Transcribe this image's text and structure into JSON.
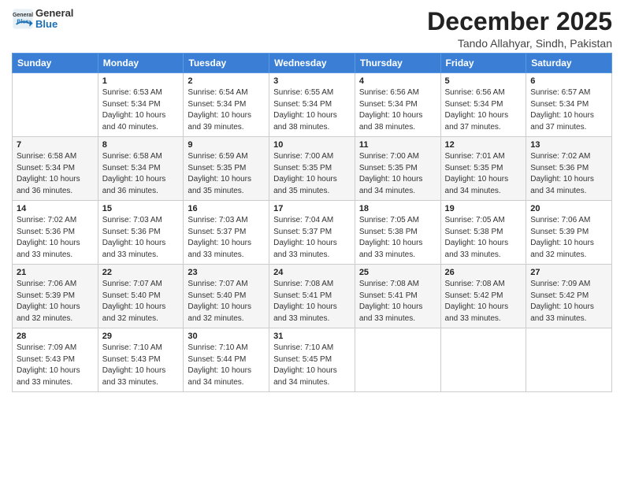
{
  "logo": {
    "line1": "General",
    "line2": "Blue"
  },
  "header": {
    "month": "December 2025",
    "location": "Tando Allahyar, Sindh, Pakistan"
  },
  "weekdays": [
    "Sunday",
    "Monday",
    "Tuesday",
    "Wednesday",
    "Thursday",
    "Friday",
    "Saturday"
  ],
  "weeks": [
    [
      {
        "day": "",
        "info": ""
      },
      {
        "day": "1",
        "info": "Sunrise: 6:53 AM\nSunset: 5:34 PM\nDaylight: 10 hours\nand 40 minutes."
      },
      {
        "day": "2",
        "info": "Sunrise: 6:54 AM\nSunset: 5:34 PM\nDaylight: 10 hours\nand 39 minutes."
      },
      {
        "day": "3",
        "info": "Sunrise: 6:55 AM\nSunset: 5:34 PM\nDaylight: 10 hours\nand 38 minutes."
      },
      {
        "day": "4",
        "info": "Sunrise: 6:56 AM\nSunset: 5:34 PM\nDaylight: 10 hours\nand 38 minutes."
      },
      {
        "day": "5",
        "info": "Sunrise: 6:56 AM\nSunset: 5:34 PM\nDaylight: 10 hours\nand 37 minutes."
      },
      {
        "day": "6",
        "info": "Sunrise: 6:57 AM\nSunset: 5:34 PM\nDaylight: 10 hours\nand 37 minutes."
      }
    ],
    [
      {
        "day": "7",
        "info": "Sunrise: 6:58 AM\nSunset: 5:34 PM\nDaylight: 10 hours\nand 36 minutes."
      },
      {
        "day": "8",
        "info": "Sunrise: 6:58 AM\nSunset: 5:34 PM\nDaylight: 10 hours\nand 36 minutes."
      },
      {
        "day": "9",
        "info": "Sunrise: 6:59 AM\nSunset: 5:35 PM\nDaylight: 10 hours\nand 35 minutes."
      },
      {
        "day": "10",
        "info": "Sunrise: 7:00 AM\nSunset: 5:35 PM\nDaylight: 10 hours\nand 35 minutes."
      },
      {
        "day": "11",
        "info": "Sunrise: 7:00 AM\nSunset: 5:35 PM\nDaylight: 10 hours\nand 34 minutes."
      },
      {
        "day": "12",
        "info": "Sunrise: 7:01 AM\nSunset: 5:35 PM\nDaylight: 10 hours\nand 34 minutes."
      },
      {
        "day": "13",
        "info": "Sunrise: 7:02 AM\nSunset: 5:36 PM\nDaylight: 10 hours\nand 34 minutes."
      }
    ],
    [
      {
        "day": "14",
        "info": "Sunrise: 7:02 AM\nSunset: 5:36 PM\nDaylight: 10 hours\nand 33 minutes."
      },
      {
        "day": "15",
        "info": "Sunrise: 7:03 AM\nSunset: 5:36 PM\nDaylight: 10 hours\nand 33 minutes."
      },
      {
        "day": "16",
        "info": "Sunrise: 7:03 AM\nSunset: 5:37 PM\nDaylight: 10 hours\nand 33 minutes."
      },
      {
        "day": "17",
        "info": "Sunrise: 7:04 AM\nSunset: 5:37 PM\nDaylight: 10 hours\nand 33 minutes."
      },
      {
        "day": "18",
        "info": "Sunrise: 7:05 AM\nSunset: 5:38 PM\nDaylight: 10 hours\nand 33 minutes."
      },
      {
        "day": "19",
        "info": "Sunrise: 7:05 AM\nSunset: 5:38 PM\nDaylight: 10 hours\nand 33 minutes."
      },
      {
        "day": "20",
        "info": "Sunrise: 7:06 AM\nSunset: 5:39 PM\nDaylight: 10 hours\nand 32 minutes."
      }
    ],
    [
      {
        "day": "21",
        "info": "Sunrise: 7:06 AM\nSunset: 5:39 PM\nDaylight: 10 hours\nand 32 minutes."
      },
      {
        "day": "22",
        "info": "Sunrise: 7:07 AM\nSunset: 5:40 PM\nDaylight: 10 hours\nand 32 minutes."
      },
      {
        "day": "23",
        "info": "Sunrise: 7:07 AM\nSunset: 5:40 PM\nDaylight: 10 hours\nand 32 minutes."
      },
      {
        "day": "24",
        "info": "Sunrise: 7:08 AM\nSunset: 5:41 PM\nDaylight: 10 hours\nand 33 minutes."
      },
      {
        "day": "25",
        "info": "Sunrise: 7:08 AM\nSunset: 5:41 PM\nDaylight: 10 hours\nand 33 minutes."
      },
      {
        "day": "26",
        "info": "Sunrise: 7:08 AM\nSunset: 5:42 PM\nDaylight: 10 hours\nand 33 minutes."
      },
      {
        "day": "27",
        "info": "Sunrise: 7:09 AM\nSunset: 5:42 PM\nDaylight: 10 hours\nand 33 minutes."
      }
    ],
    [
      {
        "day": "28",
        "info": "Sunrise: 7:09 AM\nSunset: 5:43 PM\nDaylight: 10 hours\nand 33 minutes."
      },
      {
        "day": "29",
        "info": "Sunrise: 7:10 AM\nSunset: 5:43 PM\nDaylight: 10 hours\nand 33 minutes."
      },
      {
        "day": "30",
        "info": "Sunrise: 7:10 AM\nSunset: 5:44 PM\nDaylight: 10 hours\nand 34 minutes."
      },
      {
        "day": "31",
        "info": "Sunrise: 7:10 AM\nSunset: 5:45 PM\nDaylight: 10 hours\nand 34 minutes."
      },
      {
        "day": "",
        "info": ""
      },
      {
        "day": "",
        "info": ""
      },
      {
        "day": "",
        "info": ""
      }
    ]
  ]
}
